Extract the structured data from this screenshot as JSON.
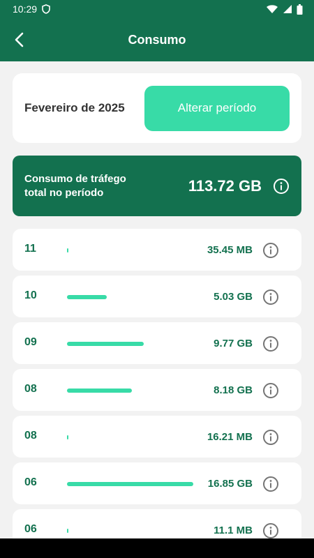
{
  "status": {
    "time": "10:29"
  },
  "appbar": {
    "title": "Consumo"
  },
  "period": {
    "label": "Fevereiro de 2025",
    "button_label": "Alterar período"
  },
  "total": {
    "label_line1": "Consumo de tráfego",
    "label_line2": "total no período",
    "value": "113.72 GB"
  },
  "colors": {
    "primary": "#13714f",
    "accent": "#38dba7"
  },
  "usage": [
    {
      "day": "11",
      "value": "35.45 MB",
      "bar_fraction": 0.0
    },
    {
      "day": "10",
      "value": "5.03 GB",
      "bar_fraction": 0.3
    },
    {
      "day": "09",
      "value": "9.77 GB",
      "bar_fraction": 0.58
    },
    {
      "day": "08",
      "value": "8.18 GB",
      "bar_fraction": 0.49
    },
    {
      "day": "08",
      "value": "16.21 MB",
      "bar_fraction": 0.0
    },
    {
      "day": "06",
      "value": "16.85 GB",
      "bar_fraction": 0.95
    },
    {
      "day": "06",
      "value": "11.1 MB",
      "bar_fraction": 0.0
    }
  ]
}
